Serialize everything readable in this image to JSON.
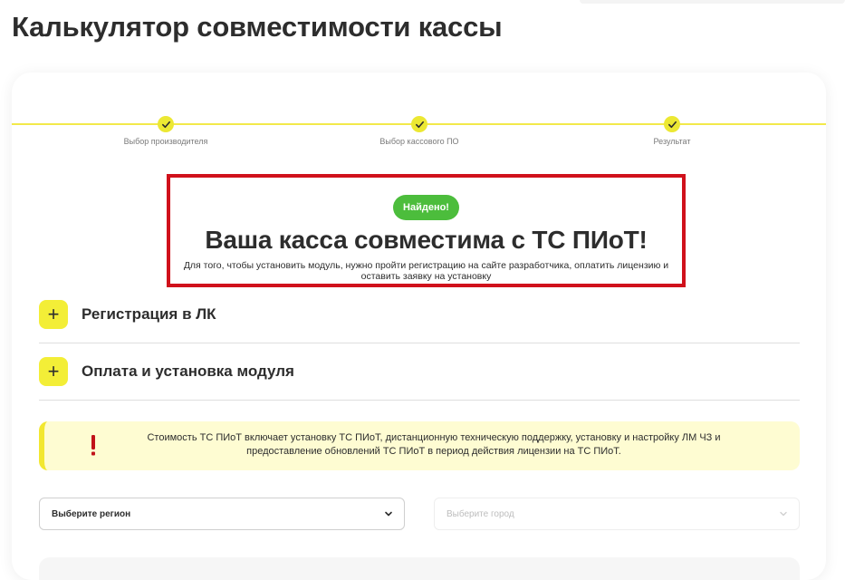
{
  "page": {
    "title": "Калькулятор совместимости кассы"
  },
  "steps": [
    {
      "label": "Выбор производителя",
      "status": "done"
    },
    {
      "label": "Выбор кассового ПО",
      "status": "done"
    },
    {
      "label": "Результат",
      "status": "done"
    }
  ],
  "result": {
    "badge": "Найдено!",
    "title": "Ваша касса совместима с ТС ПИоТ!",
    "description": "Для того, чтобы установить модуль, нужно пройти регистрацию на сайте разработчика, оплатить лицензию и оставить заявку на установку"
  },
  "accordion": [
    {
      "label": "Регистрация в ЛК",
      "icon": "plus-icon"
    },
    {
      "label": "Оплата и установка модуля",
      "icon": "plus-icon"
    }
  ],
  "notice": {
    "icon": "exclamation-icon",
    "text": "Стоимость ТС ПИоТ включает установку ТС ПИоТ, дистанционную техническую поддержку, установку и настройку ЛМ ЧЗ и предоставление обновлений ТС ПИоТ в период действия лицензии на ТС ПИоТ."
  },
  "selects": {
    "region": {
      "value": "Выберите регион",
      "enabled": true
    },
    "city": {
      "value": "Выберите город",
      "enabled": false
    }
  },
  "colors": {
    "accent_yellow": "#f3ee37",
    "success_green": "#4cbd3c",
    "highlight_red": "#d0111b",
    "notice_bg": "#fefcd2"
  }
}
